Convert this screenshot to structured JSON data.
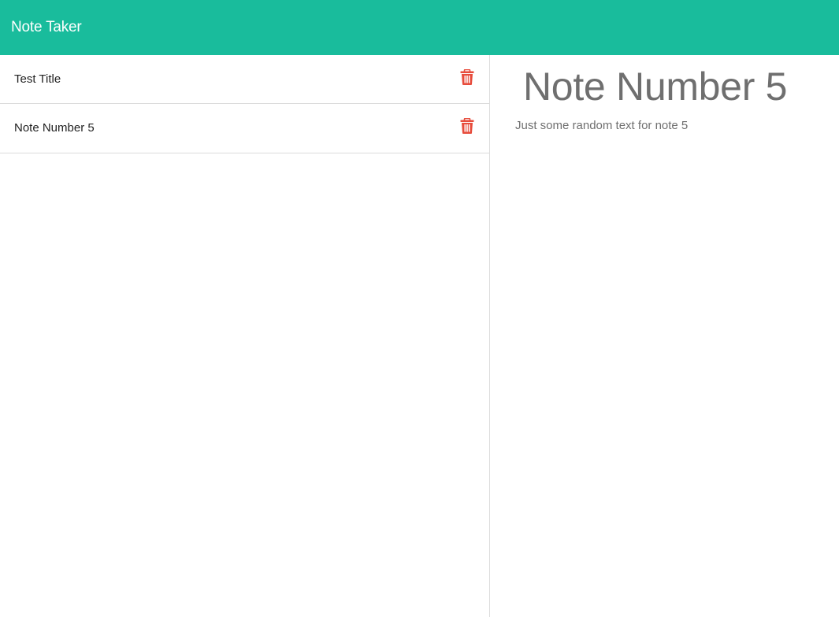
{
  "app": {
    "brand": "Note Taker"
  },
  "sidebar": {
    "notes": [
      {
        "title": "Test Title",
        "delete_icon": "trash-icon"
      },
      {
        "title": "Note Number 5",
        "delete_icon": "trash-icon"
      }
    ]
  },
  "active_note": {
    "title": "Note Number 5",
    "text": "Just some random text for note 5"
  },
  "colors": {
    "navbar": "#19bc9c",
    "delete_icon": "#e74c3c",
    "text_muted": "#6f6f6f"
  }
}
